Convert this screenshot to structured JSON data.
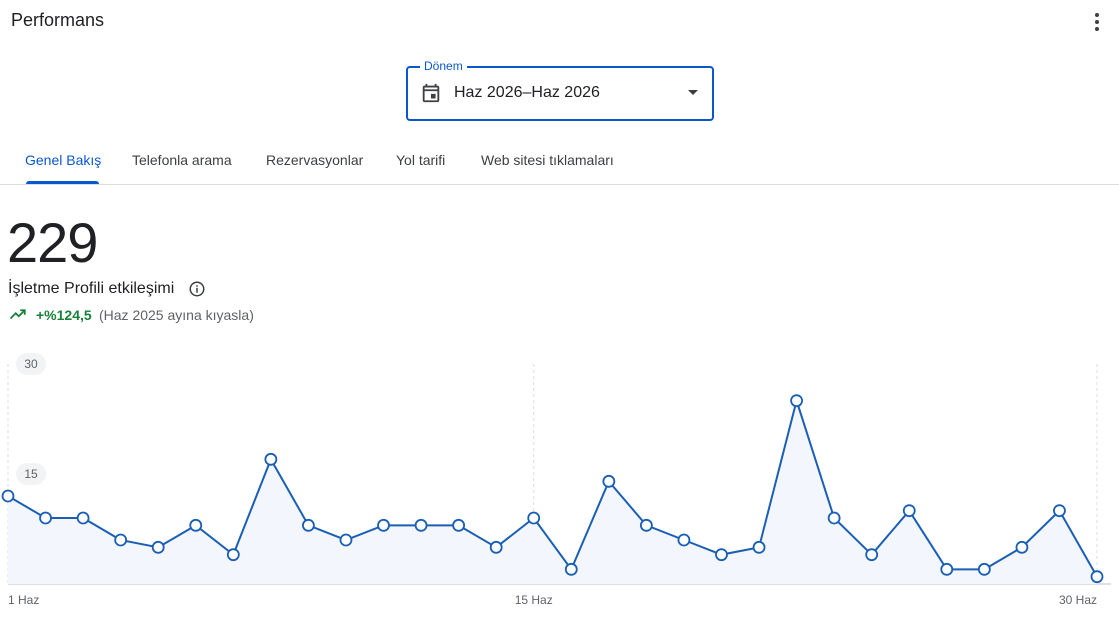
{
  "header": {
    "title": "Performans",
    "menu_icon": "more-vert-icon"
  },
  "period": {
    "label": "Dönem",
    "value": "Haz 2026–Haz 2026",
    "icon": "calendar-icon"
  },
  "tabs": [
    {
      "label": "Genel Bakış",
      "active": true
    },
    {
      "label": "Telefonla arama",
      "active": false
    },
    {
      "label": "Rezervasyonlar",
      "active": false
    },
    {
      "label": "Yol tarifi",
      "active": false
    },
    {
      "label": "Web sitesi tıklamaları",
      "active": false
    }
  ],
  "summary": {
    "total": "229",
    "metric_label": "İşletme Profili etkileşimi",
    "change": "+%124,5",
    "comparison": "(Haz 2025 ayına kıyasla)"
  },
  "colors": {
    "accent": "#0b57d0",
    "positive": "#188038",
    "line": "#1a5fb4"
  },
  "chart_data": {
    "type": "line",
    "x": [
      "1 Haz",
      "2 Haz",
      "3 Haz",
      "4 Haz",
      "5 Haz",
      "6 Haz",
      "7 Haz",
      "8 Haz",
      "9 Haz",
      "10 Haz",
      "11 Haz",
      "12 Haz",
      "13 Haz",
      "14 Haz",
      "15 Haz",
      "16 Haz",
      "17 Haz",
      "18 Haz",
      "19 Haz",
      "20 Haz",
      "21 Haz",
      "22 Haz",
      "23 Haz",
      "24 Haz",
      "25 Haz",
      "26 Haz",
      "27 Haz",
      "28 Haz",
      "29 Haz",
      "30 Haz"
    ],
    "series": [
      {
        "values": [
          12,
          9,
          9,
          6,
          5,
          8,
          4,
          17,
          8,
          6,
          8,
          8,
          8,
          5,
          9,
          2,
          14,
          8,
          6,
          4,
          5,
          25,
          9,
          4,
          10,
          2,
          2,
          5,
          10,
          1
        ]
      }
    ],
    "x_tick_labels": [
      "1 Haz",
      "15 Haz",
      "30 Haz"
    ],
    "y_tick_labels": [
      "30",
      "15"
    ],
    "ylim": [
      0,
      30
    ],
    "grid": "vertical dashed at x ticks"
  }
}
